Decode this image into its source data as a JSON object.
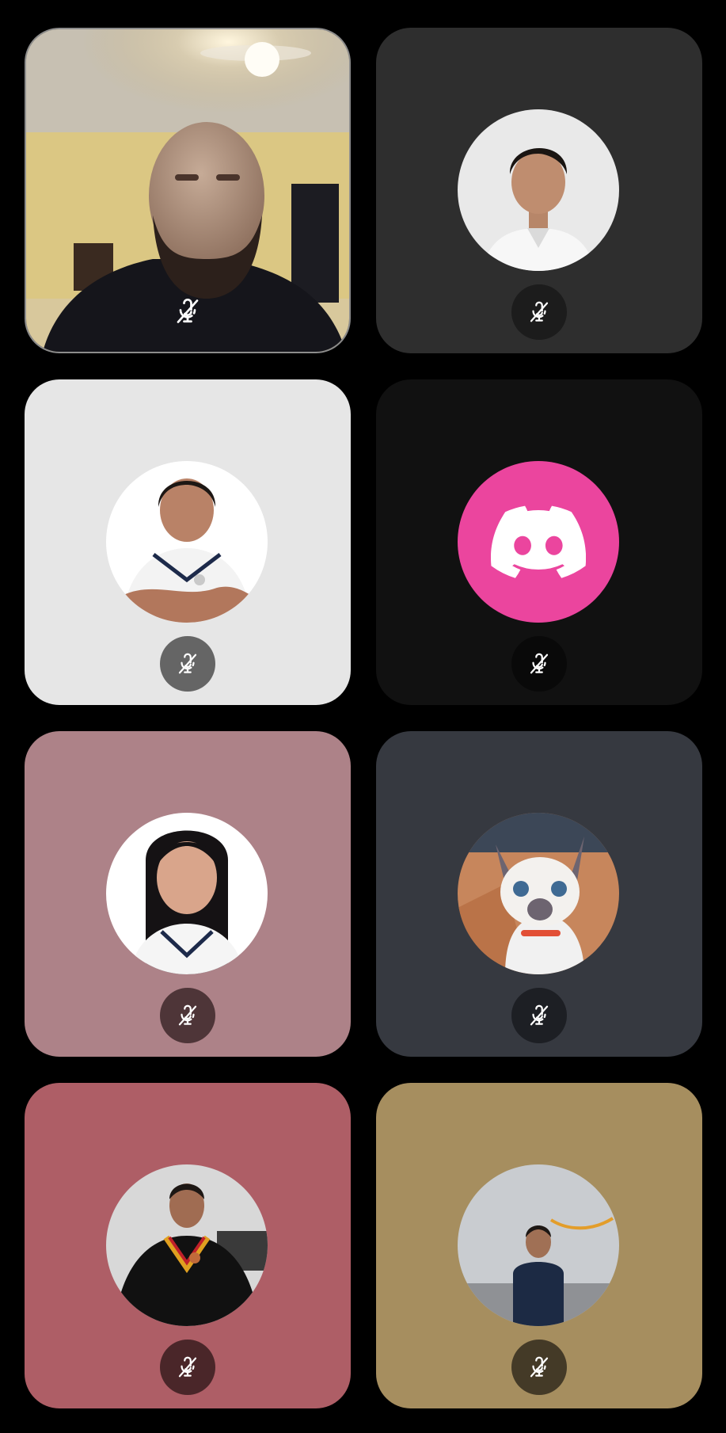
{
  "call": {
    "participants": [
      {
        "id": "p1",
        "kind": "video",
        "tile_color": "#3b3226",
        "mute_color": "#ffffff",
        "muted": true
      },
      {
        "id": "p2",
        "kind": "avatar",
        "tile_color": "#2e2e2e",
        "mute_color": "#1c1c1c",
        "muted": true
      },
      {
        "id": "p3",
        "kind": "avatar",
        "tile_color": "#e6e6e6",
        "mute_color": "#656565",
        "muted": true
      },
      {
        "id": "p4",
        "kind": "discord-default-avatar",
        "tile_color": "#111111",
        "mute_color": "#090909",
        "avatar_color": "#eb459e",
        "muted": true
      },
      {
        "id": "p5",
        "kind": "avatar",
        "tile_color": "#ad8288",
        "mute_color": "#4e3538",
        "muted": true
      },
      {
        "id": "p6",
        "kind": "avatar",
        "tile_color": "#363940",
        "mute_color": "#1d1f24",
        "muted": true
      },
      {
        "id": "p7",
        "kind": "avatar",
        "tile_color": "#ae5e66",
        "mute_color": "#4a2629",
        "muted": true
      },
      {
        "id": "p8",
        "kind": "avatar",
        "tile_color": "#a68e5f",
        "mute_color": "#443a27",
        "muted": true
      }
    ]
  },
  "icons": {
    "mute": "microphone-muted-icon",
    "discord": "discord-logo-icon"
  }
}
